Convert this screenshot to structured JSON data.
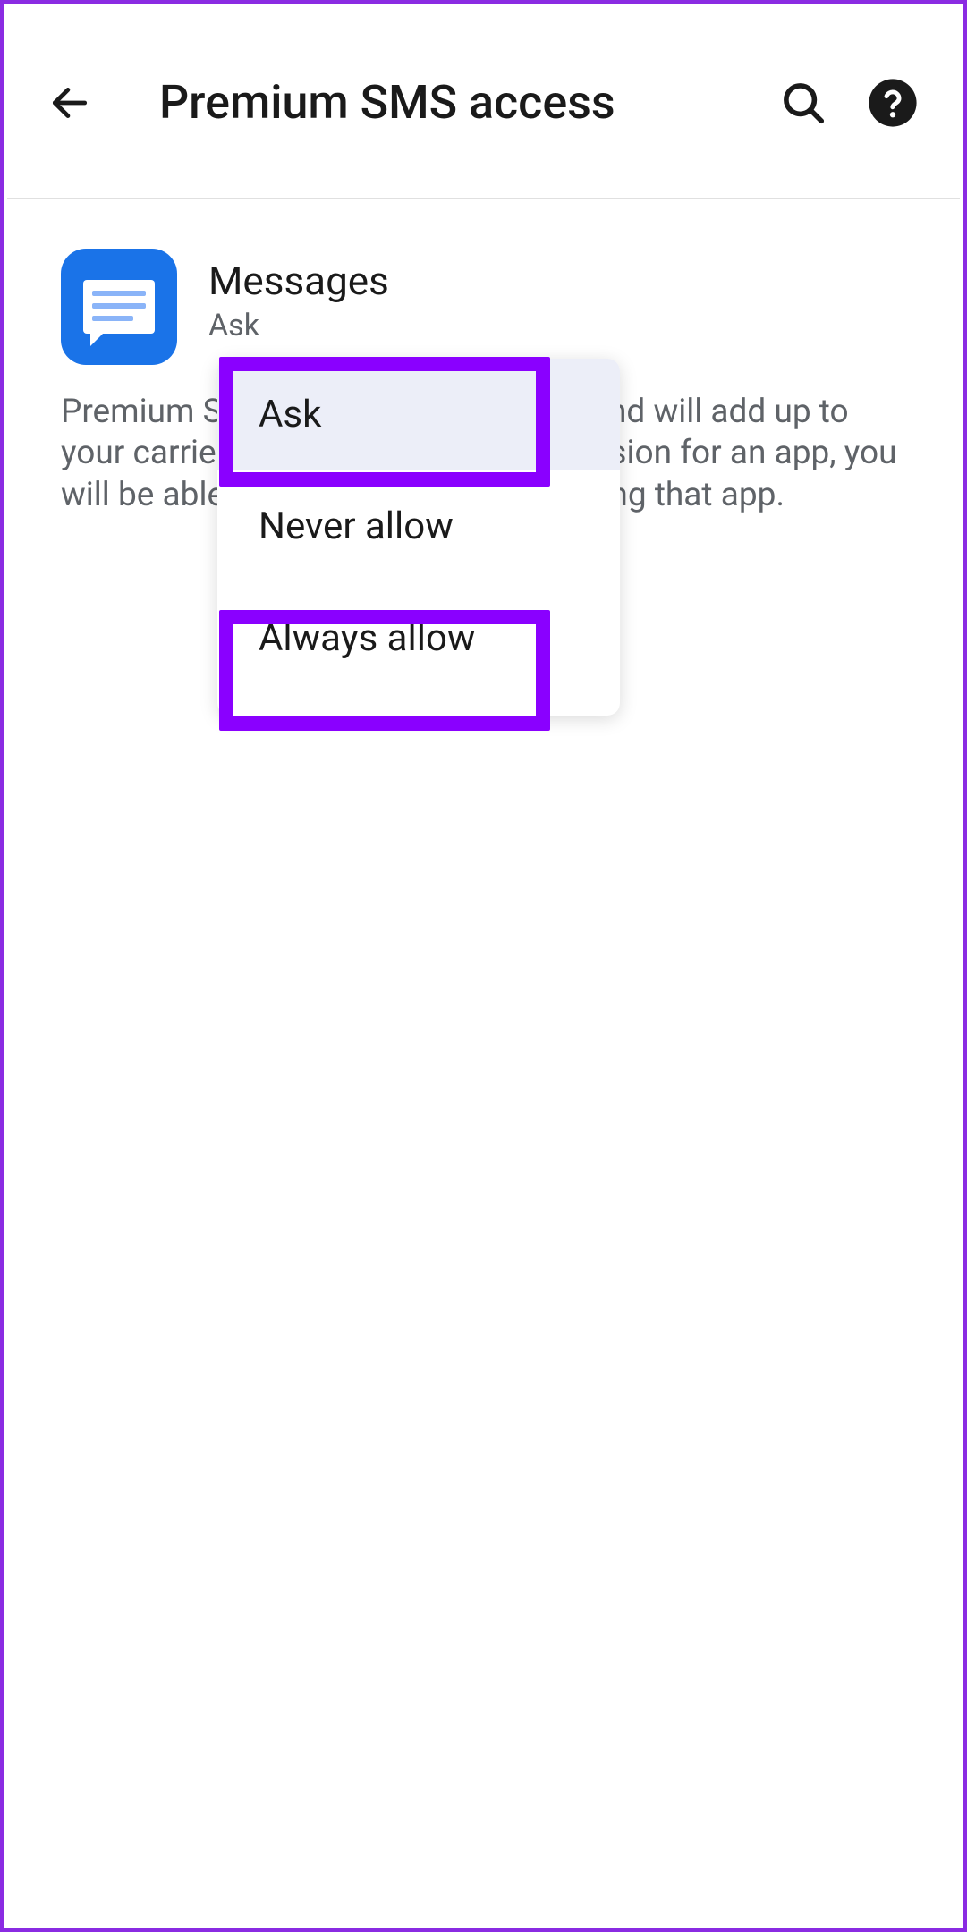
{
  "appbar": {
    "title": "Premium SMS access"
  },
  "app": {
    "name": "Messages",
    "status": "Ask"
  },
  "description": "Premium SMS may cost you money and will add up to your carrier bills. If you enable permission for an app, you will be able to send premium SMS using that app.",
  "dropdown": {
    "options": [
      {
        "label": "Ask"
      },
      {
        "label": "Never allow"
      },
      {
        "label": "Always allow"
      }
    ]
  }
}
